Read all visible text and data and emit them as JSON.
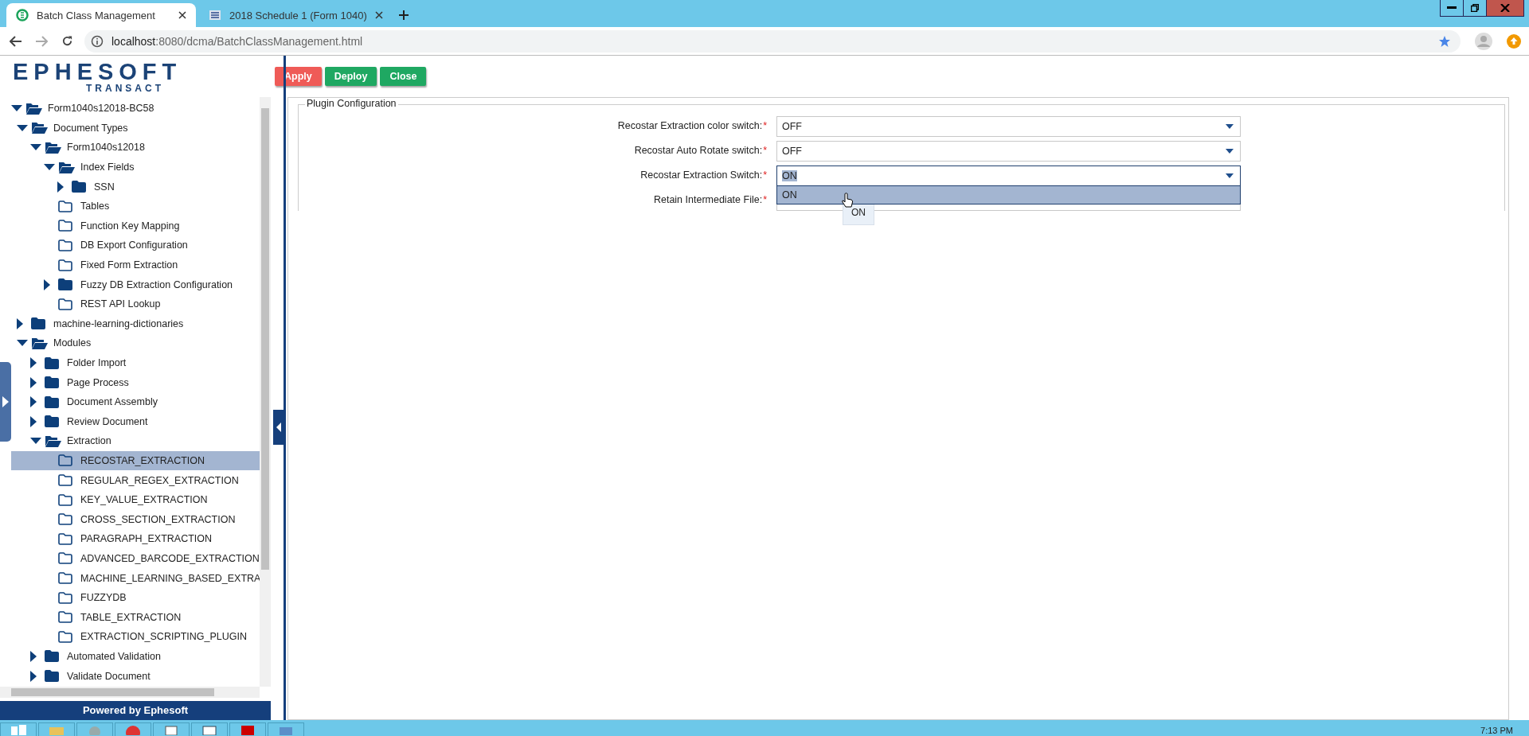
{
  "browser": {
    "tabs": [
      {
        "title": "Batch Class Management",
        "selected": true,
        "kind": "app"
      },
      {
        "title": "2018 Schedule 1 (Form 1040)",
        "selected": false,
        "kind": "doc"
      }
    ],
    "address": {
      "host": "localhost",
      "path": ":8080/dcma/BatchClassManagement.html"
    }
  },
  "logo": {
    "name": "EPHESOFT",
    "subtitle": "TRANSACT"
  },
  "toolbar": [
    {
      "label": "Apply",
      "kind": "danger"
    },
    {
      "label": "Deploy",
      "kind": "primary"
    },
    {
      "label": "Close",
      "kind": "primary"
    }
  ],
  "tree": [
    {
      "label": "Form1040s12018-BC58",
      "kind": "folder",
      "expanded": true,
      "selected": false,
      "children": [
        {
          "label": "Document Types",
          "kind": "folder",
          "expanded": true,
          "selected": false,
          "children": [
            {
              "label": "Form1040s12018",
              "kind": "folder",
              "expanded": true,
              "selected": false,
              "children": [
                {
                  "label": "Index Fields",
                  "kind": "folder",
                  "expanded": true,
                  "selected": false,
                  "children": [
                    {
                      "label": "SSN",
                      "kind": "folder",
                      "expanded": false,
                      "selected": false
                    }
                  ]
                },
                {
                  "label": "Tables",
                  "kind": "leaf",
                  "selected": false
                },
                {
                  "label": "Function Key Mapping",
                  "kind": "leaf",
                  "selected": false
                },
                {
                  "label": "DB Export Configuration",
                  "kind": "leaf",
                  "selected": false
                },
                {
                  "label": "Fixed Form Extraction",
                  "kind": "leaf",
                  "selected": false
                },
                {
                  "label": "Fuzzy DB Extraction Configuration",
                  "kind": "folder",
                  "expanded": false,
                  "selected": false
                },
                {
                  "label": "REST API Lookup",
                  "kind": "leaf",
                  "selected": false
                }
              ]
            }
          ]
        },
        {
          "label": "machine-learning-dictionaries",
          "kind": "folder",
          "expanded": false,
          "selected": false
        },
        {
          "label": "Modules",
          "kind": "folder",
          "expanded": true,
          "selected": false,
          "children": [
            {
              "label": "Folder Import",
              "kind": "folder",
              "expanded": false,
              "selected": false
            },
            {
              "label": "Page Process",
              "kind": "folder",
              "expanded": false,
              "selected": false
            },
            {
              "label": "Document Assembly",
              "kind": "folder",
              "expanded": false,
              "selected": false
            },
            {
              "label": "Review Document",
              "kind": "folder",
              "expanded": false,
              "selected": false
            },
            {
              "label": "Extraction",
              "kind": "folder",
              "expanded": true,
              "selected": false,
              "children": [
                {
                  "label": "RECOSTAR_EXTRACTION",
                  "kind": "leaf",
                  "selected": true
                },
                {
                  "label": "REGULAR_REGEX_EXTRACTION",
                  "kind": "leaf",
                  "selected": false
                },
                {
                  "label": "KEY_VALUE_EXTRACTION",
                  "kind": "leaf",
                  "selected": false
                },
                {
                  "label": "CROSS_SECTION_EXTRACTION",
                  "kind": "leaf",
                  "selected": false
                },
                {
                  "label": "PARAGRAPH_EXTRACTION",
                  "kind": "leaf",
                  "selected": false
                },
                {
                  "label": "ADVANCED_BARCODE_EXTRACTION",
                  "kind": "leaf",
                  "selected": false
                },
                {
                  "label": "MACHINE_LEARNING_BASED_EXTRA",
                  "kind": "leaf",
                  "selected": false
                },
                {
                  "label": "FUZZYDB",
                  "kind": "leaf",
                  "selected": false
                },
                {
                  "label": "TABLE_EXTRACTION",
                  "kind": "leaf",
                  "selected": false
                },
                {
                  "label": "EXTRACTION_SCRIPTING_PLUGIN",
                  "kind": "leaf",
                  "selected": false
                }
              ]
            },
            {
              "label": "Automated Validation",
              "kind": "folder",
              "expanded": false,
              "selected": false
            },
            {
              "label": "Validate Document",
              "kind": "folder",
              "expanded": false,
              "selected": false
            }
          ]
        }
      ]
    }
  ],
  "footer": "Powered by Ephesoft",
  "panel": {
    "title": "Plugin Configuration",
    "fields": [
      {
        "label": "Recostar Extraction color switch:",
        "required": true,
        "value": "OFF",
        "open": false,
        "value_highlighted": false
      },
      {
        "label": "Recostar Auto Rotate switch:",
        "required": true,
        "value": "OFF",
        "open": false,
        "value_highlighted": false
      },
      {
        "label": "Recostar Extraction Switch:",
        "required": true,
        "value": "ON",
        "open": true,
        "value_highlighted": true,
        "options": [
          {
            "label": "ON",
            "selected": true
          }
        ]
      },
      {
        "label": "Retain Intermediate File:",
        "required": true,
        "open": false
      }
    ],
    "tooltip": "ON"
  },
  "taskbar": {
    "clock": "7:13 PM"
  },
  "required_mark": "*"
}
